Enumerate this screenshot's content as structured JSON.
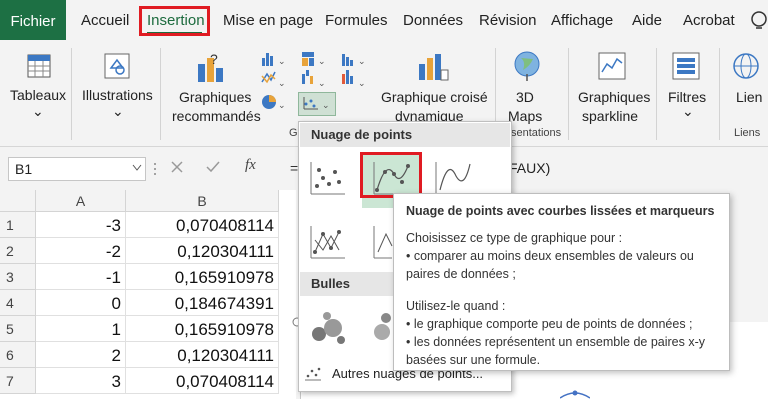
{
  "tabs": {
    "fichier": "Fichier",
    "accueil": "Accueil",
    "insertion": "Insertion",
    "mise_en_page": "Mise en page",
    "formules": "Formules",
    "donnees": "Données",
    "revision": "Révision",
    "affichage": "Affichage",
    "aide": "Aide",
    "acrobat": "Acrobat"
  },
  "ribbon": {
    "tableaux": "Tableaux",
    "illustrations": "Illustrations",
    "graphiques_line1": "Graphiques",
    "graphiques_line2": "recommandés",
    "croise_line1": "Graphique croisé",
    "croise_line2": "dynamique",
    "maps_line1": "3D",
    "maps_line2": "Maps",
    "sparkline_line1": "Graphiques",
    "sparkline_line2": "sparkline",
    "filtres": "Filtres",
    "lien": "Lien",
    "group_graph_partial": "Gr",
    "group_presentations_partial": "sentations",
    "group_liens": "Liens",
    "chevron": "⌄"
  },
  "formula": {
    "name_box": "B1",
    "fx": "fx",
    "content_partial": "FAUX)"
  },
  "grid": {
    "col_a": "A",
    "col_b": "B",
    "rows": [
      {
        "num": "1",
        "a": "-3",
        "b": "0,070408114"
      },
      {
        "num": "2",
        "a": "-2",
        "b": "0,120304111"
      },
      {
        "num": "3",
        "a": "-1",
        "b": "0,165910978"
      },
      {
        "num": "4",
        "a": "0",
        "b": "0,184674391"
      },
      {
        "num": "5",
        "a": "1",
        "b": "0,165910978"
      },
      {
        "num": "6",
        "a": "2",
        "b": "0,120304111"
      },
      {
        "num": "7",
        "a": "3",
        "b": "0,070408114"
      }
    ]
  },
  "dropdown": {
    "section_scatter": "Nuage de points",
    "section_bubbles": "Bulles",
    "more": "Autres nuages de points..."
  },
  "tooltip": {
    "title": "Nuage de points avec courbes lissées et marqueurs",
    "l1": "Choisissez ce type de graphique pour :",
    "l2": "• comparer au moins deux ensembles de valeurs ou",
    "l3": "paires de données ;",
    "l4": "Utilisez-le quand :",
    "l5": "• le graphique comporte peu de points de données ;",
    "l6": "• les données représentent un ensemble de paires x-y",
    "l7": "basées sur une formule."
  },
  "colors": {
    "excel_green": "#1d7044",
    "highlight_red": "#e01b22",
    "selected_fill": "#cbe6d4"
  }
}
